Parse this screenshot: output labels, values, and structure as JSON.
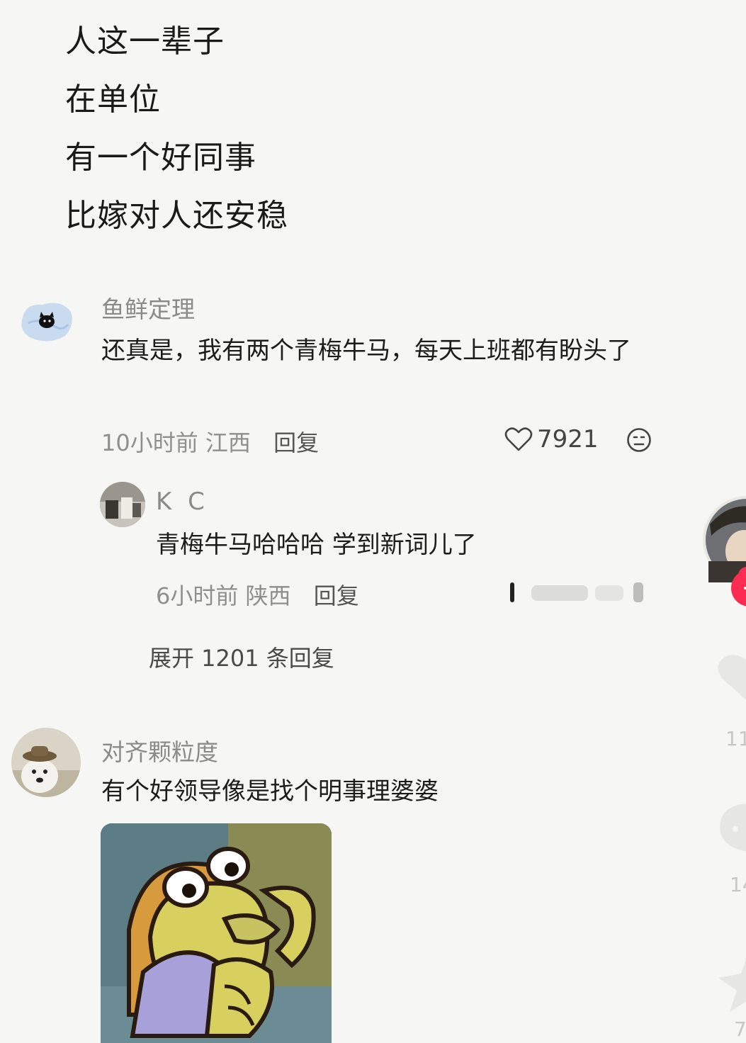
{
  "post": {
    "lines": [
      "人这一辈子",
      "在单位",
      "有一个好同事",
      "比嫁对人还安稳"
    ]
  },
  "comments": [
    {
      "username": "鱼鲜定理",
      "text": "还真是，我有两个青梅牛马，每天上班都有盼头了",
      "time": "10小时前",
      "location": "江西",
      "reply_label": "回复",
      "likes": "7921",
      "avatar_icon": "black-cat-avatar-icon",
      "reply": {
        "username": "K C",
        "text": "青梅牛马哈哈哈 学到新词儿了",
        "time": "6小时前",
        "location": "陕西",
        "reply_label": "回复"
      },
      "expand_label": "展开 1201 条回复"
    },
    {
      "username": "对齐颗粒度",
      "text": "有个好领导像是找个明事理婆婆",
      "avatar_icon": "dog-with-hat-avatar-icon",
      "sticker_icon": "cartoon-fish-sticker-icon"
    }
  ],
  "side": {
    "like_count_partial": "11",
    "comment_count_partial": "14",
    "share_count_partial": "7",
    "follow_symbol": "+"
  },
  "colors": {
    "background": "#f6f6f4",
    "text": "#1b1b1b",
    "meta": "#8f8f8f",
    "follow_red": "#fe2c55"
  }
}
